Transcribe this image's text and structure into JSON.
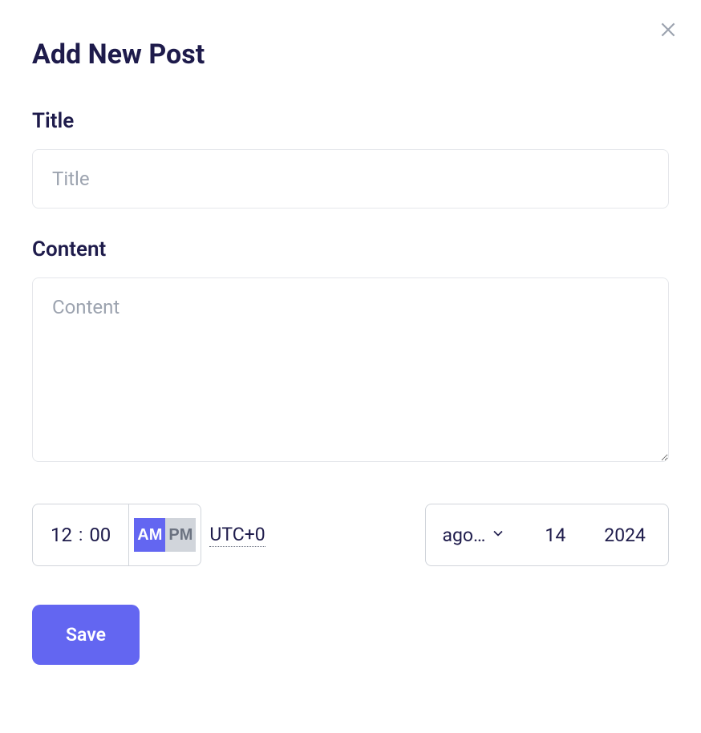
{
  "modal": {
    "title": "Add New Post"
  },
  "fields": {
    "title": {
      "label": "Title",
      "placeholder": "Title",
      "value": ""
    },
    "content": {
      "label": "Content",
      "placeholder": "Content",
      "value": ""
    }
  },
  "time": {
    "hour": "12",
    "minute": "00",
    "am": "AM",
    "pm": "PM",
    "timezone": "UTC+0"
  },
  "date": {
    "month": "ago…",
    "day": "14",
    "year": "2024"
  },
  "actions": {
    "save": "Save"
  }
}
